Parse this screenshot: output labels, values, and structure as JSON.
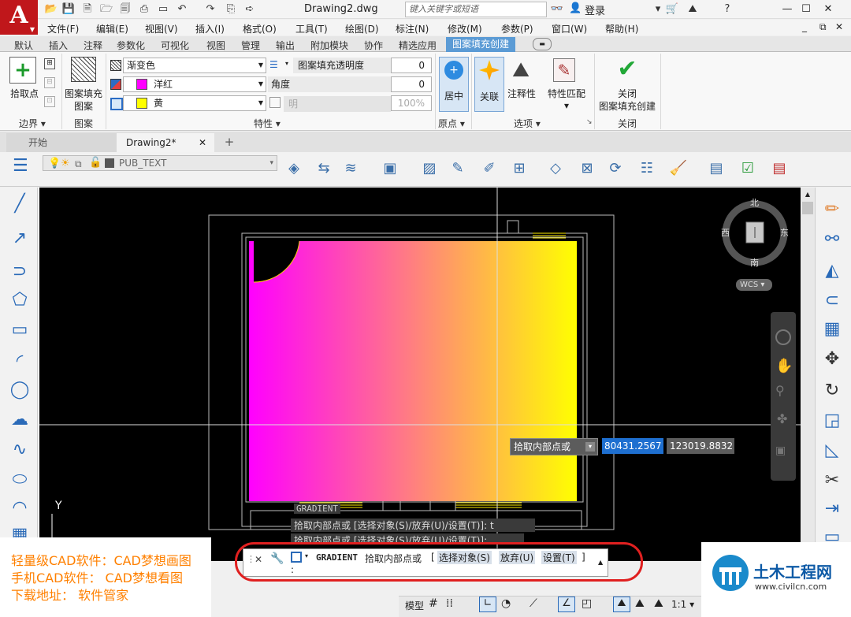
{
  "titlebar": {
    "app_logo": "A",
    "doc_title": "Drawing2.dwg",
    "search_placeholder": "键入关键字或短语",
    "login": "登录"
  },
  "menu": [
    "文件(F)",
    "编辑(E)",
    "视图(V)",
    "插入(I)",
    "格式(O)",
    "工具(T)",
    "绘图(D)",
    "标注(N)",
    "修改(M)",
    "参数(P)",
    "窗口(W)",
    "帮助(H)"
  ],
  "ribbon_tabs": [
    "默认",
    "插入",
    "注释",
    "参数化",
    "可视化",
    "视图",
    "管理",
    "输出",
    "附加模块",
    "协作",
    "精选应用"
  ],
  "ribbon_active_tab": "图案填充创建",
  "ribbon": {
    "pick_point": "拾取点",
    "boundary_panel": "边界",
    "pattern_btn_line1": "图案填充",
    "pattern_btn_line2": "图案",
    "pattern_panel": "图案",
    "hatch_type": "渐变色",
    "color1_name": "洋红",
    "color1": "#ff00ff",
    "color2_name": "黄",
    "color2": "#ffff00",
    "transparency_label": "图案填充透明度",
    "transparency_value": "0",
    "angle_label": "角度",
    "angle_value": "0",
    "tint_label": "明",
    "tint_value": "100%",
    "properties_panel": "特性",
    "center": "居中",
    "origin_panel": "原点",
    "associative": "关联",
    "annotative": "注释性",
    "match_props": "特性匹配",
    "options_panel": "选项",
    "close_line1": "关闭",
    "close_line2": "图案填充创建",
    "close_panel": "关闭"
  },
  "doc_tabs": {
    "start": "开始",
    "drawing": "Drawing2*",
    "plus": "+"
  },
  "layer": {
    "name": "PUB_TEXT"
  },
  "viewcube": {
    "north": "北",
    "south": "南",
    "east": "东",
    "west": "西",
    "wcs": "WCS"
  },
  "canvas": {
    "y_axis": "Y",
    "gradient_label": "GRADIENT",
    "history_line1": "拾取内部点或 [选择对象(S)/放弃(U)/设置(T)]: t",
    "history_line2": "拾取内部点或 [选择对象(S)/放弃(U)/设置(T)]:",
    "tooltip_prompt": "拾取内部点或",
    "coord_x": "80431.2567",
    "coord_y": "123019.8832"
  },
  "cmdline": {
    "command": "GRADIENT",
    "prompt": "拾取内部点或",
    "bracket_open": "[",
    "opt_select": "选择对象(S)",
    "opt_undo": "放弃(U)",
    "opt_settings": "设置(T)",
    "bracket_close": "]",
    "input": ":"
  },
  "promo": {
    "line1": "轻量级CAD软件：CAD梦想画图",
    "line2": "手机CAD软件：  CAD梦想看图",
    "line3": "下载地址：    软件管家"
  },
  "site_logo": {
    "name": "土木工程网",
    "url": "www.civilcn.com"
  },
  "statusbar": {
    "model": "模型",
    "scale": "1:1"
  }
}
